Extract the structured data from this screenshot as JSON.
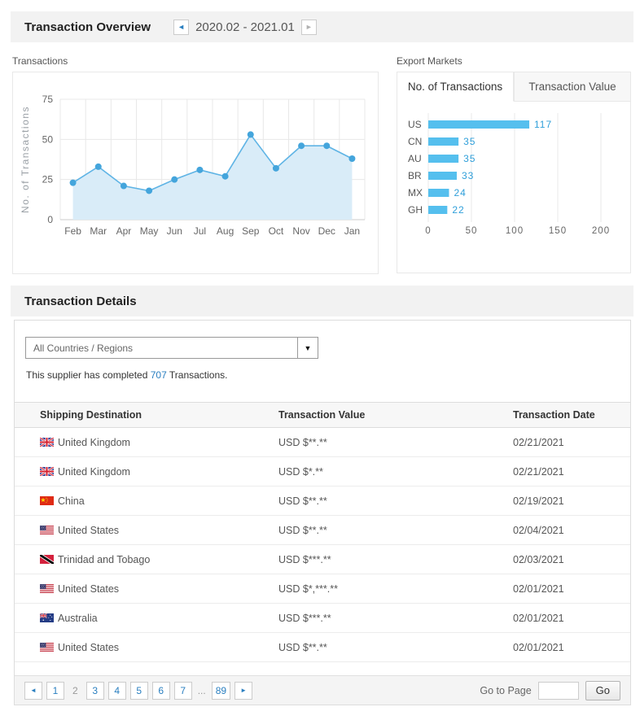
{
  "overview": {
    "title": "Transaction Overview",
    "date_range": "2020.02 - 2021.01",
    "transactions_label": "Transactions",
    "export_markets_label": "Export Markets",
    "tabs": [
      {
        "label": "No. of Transactions",
        "active": true
      },
      {
        "label": "Transaction Value",
        "active": false
      }
    ]
  },
  "icons": {
    "prev": "◄",
    "next": "►",
    "caret_down": "▼",
    "ellipsis": "..."
  },
  "chart_data": [
    {
      "type": "area",
      "title": "Transactions",
      "x": [
        "Feb",
        "Mar",
        "Apr",
        "May",
        "Jun",
        "Jul",
        "Aug",
        "Sep",
        "Oct",
        "Nov",
        "Dec",
        "Jan"
      ],
      "values": [
        23,
        33,
        21,
        18,
        25,
        31,
        27,
        53,
        32,
        46,
        46,
        38
      ],
      "ylabel": "No. of Transactions",
      "xlabel": "",
      "ylim": [
        0,
        75
      ],
      "yticks": [
        0,
        25,
        50,
        75
      ],
      "grid": true,
      "legend": "none"
    },
    {
      "type": "bar",
      "title": "Export Markets - No. of Transactions",
      "orientation": "horizontal",
      "categories": [
        "US",
        "CN",
        "AU",
        "BR",
        "MX",
        "GH"
      ],
      "values": [
        117,
        35,
        35,
        33,
        24,
        22
      ],
      "xlim": [
        0,
        200
      ],
      "xticks": [
        0,
        50,
        100,
        150,
        200
      ],
      "grid": true,
      "legend": "none"
    }
  ],
  "details": {
    "title": "Transaction Details",
    "filter_value": "All Countries / Regions",
    "summary_prefix": "This supplier has completed ",
    "summary_count": "707",
    "summary_suffix": " Transactions.",
    "table": {
      "columns": [
        "Shipping Destination",
        "Transaction Value",
        "Transaction Date"
      ],
      "rows": [
        {
          "flag": "gb",
          "country": "United Kingdom",
          "value": "USD $**.**",
          "date": "02/21/2021"
        },
        {
          "flag": "gb",
          "country": "United Kingdom",
          "value": "USD $*.**",
          "date": "02/21/2021"
        },
        {
          "flag": "cn",
          "country": "China",
          "value": "USD $**.**",
          "date": "02/19/2021"
        },
        {
          "flag": "us",
          "country": "United States",
          "value": "USD $**.**",
          "date": "02/04/2021"
        },
        {
          "flag": "tt",
          "country": "Trinidad and Tobago",
          "value": "USD $***.**",
          "date": "02/03/2021"
        },
        {
          "flag": "us",
          "country": "United States",
          "value": "USD $*,***.**",
          "date": "02/01/2021"
        },
        {
          "flag": "au",
          "country": "Australia",
          "value": "USD $***.**",
          "date": "02/01/2021"
        },
        {
          "flag": "us",
          "country": "United States",
          "value": "USD $**.**",
          "date": "02/01/2021"
        }
      ]
    },
    "pagination": {
      "items": [
        {
          "kind": "prev",
          "label": "◄"
        },
        {
          "kind": "page",
          "label": "1"
        },
        {
          "kind": "current",
          "label": "2"
        },
        {
          "kind": "page",
          "label": "3"
        },
        {
          "kind": "page",
          "label": "4"
        },
        {
          "kind": "page",
          "label": "5"
        },
        {
          "kind": "page",
          "label": "6"
        },
        {
          "kind": "page",
          "label": "7"
        },
        {
          "kind": "ellipsis",
          "label": "..."
        },
        {
          "kind": "page",
          "label": "89"
        },
        {
          "kind": "next",
          "label": "►"
        }
      ],
      "goto_label": "Go to Page",
      "go_button": "Go"
    }
  },
  "colors": {
    "accent_blue": "#2a7fc0",
    "line_blue": "#5fb4e5",
    "marker_blue": "#44a5dc",
    "area_fill": "#d9ecf8",
    "bar_blue": "#55bfee",
    "value_label_blue": "#2f9fda",
    "grid_gray": "#e8e8e8",
    "axis_gray": "#cccccc",
    "tick_text": "#666666",
    "axis_title_gray": "#9aa0a6"
  }
}
